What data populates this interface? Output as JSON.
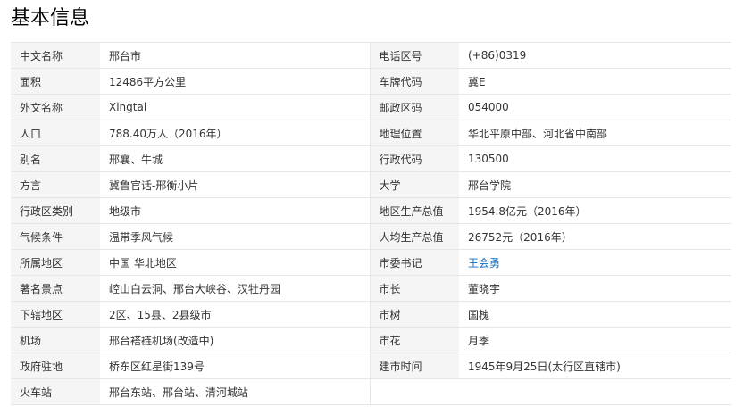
{
  "title": "基本信息",
  "colors": {
    "link": "#136ec2",
    "key_bg": "#f5f5f5",
    "border": "#e6e6e6"
  },
  "rows": [
    {
      "k1": "中文名称",
      "v1": "邢台市",
      "k2": "电话区号",
      "v2": "(+86)0319"
    },
    {
      "k1": "面积",
      "v1": "12486平方公里",
      "k2": "车牌代码",
      "v2": "冀E"
    },
    {
      "k1": "外文名称",
      "v1": "Xingtai",
      "k2": "邮政区码",
      "v2": "054000"
    },
    {
      "k1": "人口",
      "v1": "788.40万人（2016年）",
      "k2": "地理位置",
      "v2": "华北平原中部、河北省中南部"
    },
    {
      "k1": "别名",
      "v1": "邢襄、牛城",
      "k2": "行政代码",
      "v2": "130500"
    },
    {
      "k1": "方言",
      "v1": "冀鲁官话-邢衡小片",
      "k2": "大学",
      "v2": "邢台学院"
    },
    {
      "k1": "行政区类别",
      "v1": "地级市",
      "k2": "地区生产总值",
      "v2": "1954.8亿元（2016年）"
    },
    {
      "k1": "气候条件",
      "v1": "温带季风气候",
      "k2": "人均生产总值",
      "v2": "26752元（2016年）"
    },
    {
      "k1": "所属地区",
      "v1": "中国 华北地区",
      "k2": "市委书记",
      "v2": "王会勇"
    },
    {
      "k1": "著名景点",
      "v1": "崆山白云洞、邢台大峡谷、汉牡丹园",
      "k2": "市长",
      "v2": "董晓宇"
    },
    {
      "k1": "下辖地区",
      "v1": "2区、15县、2县级市",
      "k2": "市树",
      "v2": "国槐"
    },
    {
      "k1": "机场",
      "v1": "邢台褡裢机场(改造中)",
      "k2": "市花",
      "v2": "月季"
    },
    {
      "k1": "政府驻地",
      "v1": "桥东区红星街139号",
      "k2": "建市时间",
      "v2": "1945年9月25日(太行区直辖市)"
    },
    {
      "k1": "火车站",
      "v1": "邢台东站、邢台站、清河城站"
    }
  ]
}
